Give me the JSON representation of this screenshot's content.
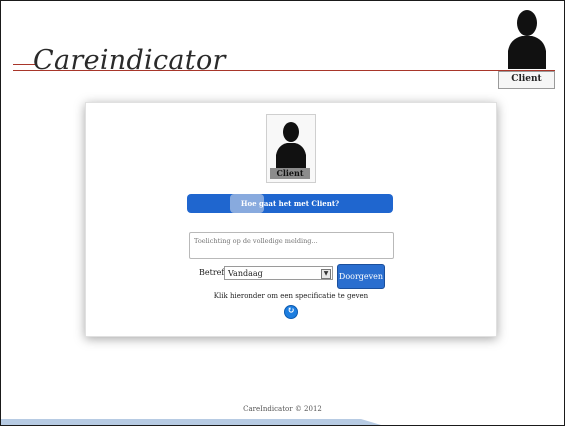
{
  "brand": {
    "logo_text": "Careindicator"
  },
  "header": {
    "avatar_label": "Client",
    "avatar_icon": "person-silhouette-icon"
  },
  "card": {
    "avatar_label": "Client",
    "avatar_icon": "person-silhouette-icon",
    "status_prompt": "Hoe gaat het met Client?",
    "status_level_percent": 18,
    "note_placeholder": "Toelichting op de volledige melding...",
    "note_value": "",
    "betreft_label": "Betreft:",
    "betreft_selected": "Vandaag",
    "submit_label": "Doorgeven",
    "hint_text": "Klik hieronder om een specificatie te geven",
    "spec_icon": "refresh-circle-icon"
  },
  "footer": {
    "copyright": "CareIndicator © 2012"
  },
  "colors": {
    "accent_blue": "#1f66cf",
    "logo_rule": "#a8362a",
    "bottom_wave": "#b7cbe3"
  }
}
